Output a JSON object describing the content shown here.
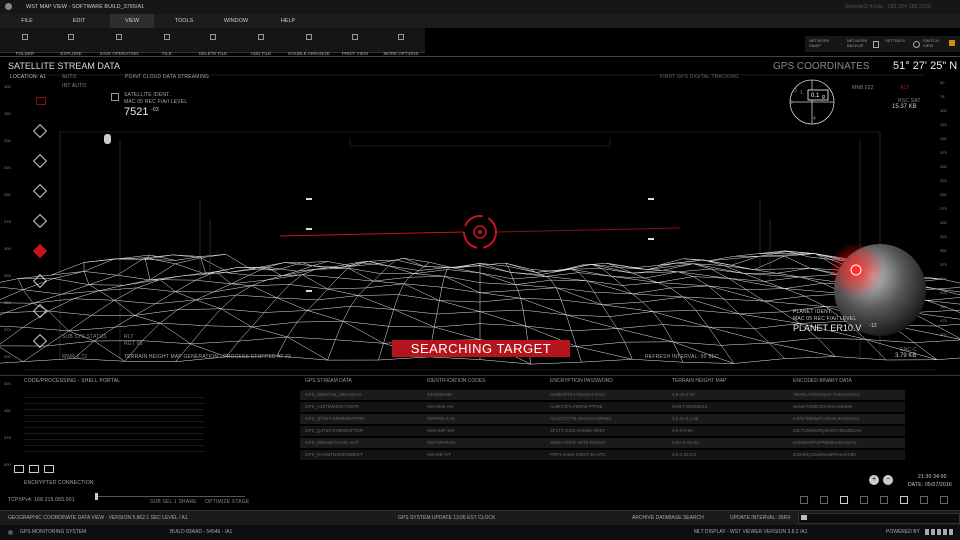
{
  "window": {
    "title": "WST MAP VIEW - SOFTWARE BUILD_3765/A1",
    "host_info": "Gnsstar3742sts : 185.264.188.2256"
  },
  "menu": [
    "FILE",
    "EDIT",
    "VIEW",
    "TOOLS",
    "WINDOW",
    "HELP"
  ],
  "toolbar": [
    "FOLDER",
    "EXPLORE",
    "SAVE OPERATION",
    "FILE",
    "DELETE FILE",
    "ADD FILE",
    "DOUBLE ARRANGE",
    "PRINT VIEW",
    "MORE OPTIONS"
  ],
  "right_toolbar": [
    "NETWORK SWAP",
    "NETWORK BACKUP",
    "SETTINGS",
    "SWITCH VIEW"
  ],
  "header": {
    "left_title": "SATELLITE STREAM DATA",
    "location": "LOCATION: A1",
    "auto1": "AUTO",
    "auto2": "INT AUTO",
    "stream": "POINT CLOUD DATA STREAMING",
    "gps_title": "GPS COORDINATES",
    "gps_value": "51° 27' 25\" N",
    "gps_sub": "FIRST GPS DIGITAL TRACKING"
  },
  "satellite": {
    "ident": "SATELLITE IDENT.",
    "rec": "MAC 05 REC F/A/I LEVEL",
    "value": "7521",
    "exp": "-03"
  },
  "compass": {
    "value": "0.1",
    "unit": "g",
    "ticks": [
      "1",
      "2",
      "3",
      "4"
    ]
  },
  "right_stats": {
    "code": "MN8.022",
    "red_label": "ALT",
    "rsc": "RSC SAT",
    "kb1": "15.37 KB",
    "enc": "ENC-C",
    "kb2": "3.79 KB"
  },
  "planet": {
    "ident": "PLANET IDENT.",
    "rec": "MAC 05 REC F/A/I LEVEL",
    "name": "PLANET ER10.V",
    "exp": "-12"
  },
  "scene": {
    "left_note_1": "MWR 0.72",
    "left_note_2": "SUB SYS STATUS",
    "terrain": "TERRAIN HEIGHT MAP GENERATION - PROCESS STOPPED AT 22",
    "refresh": "REFRESH INTERVAL: 00 SEC",
    "rlt": "RLT",
    "rlt2": "RGT 00",
    "target_label": "SEARCHING TARGET"
  },
  "ruler": [
    "100",
    "150",
    "200",
    "225",
    "250",
    "275",
    "300",
    "325",
    "350",
    "375",
    "400",
    "425",
    "450",
    "475",
    "500"
  ],
  "right_ruler": [
    "50",
    "75",
    "100",
    "125",
    "150",
    "175",
    "200",
    "225",
    "250",
    "275",
    "300",
    "325",
    "350",
    "375",
    "400",
    "425",
    "450",
    "475",
    "500"
  ],
  "code_panel": {
    "title": "CODE/PROCESSING - SHELL PORTAL",
    "encrypted": "ENCRYPTED CONNECTION",
    "ip": "TCP/IPv4: 168.215.055.001",
    "slider": "SUB SEL 1 SHARE",
    "slider2": "OPTIMIZE STAGE"
  },
  "table": {
    "headers": [
      "GPS STREAM DATA",
      "IDENTIFICATION CODES",
      "ENCRYPTION PASSWORD",
      "TERRAIN HEIGHT MAP",
      "ENCODED BINARY DATA"
    ],
    "rows": [
      [
        "GPS_NBR0736_0BEA2/2.G",
        "S4O008C88",
        "GK8D4F5TJ-FB4G8-FJA01",
        "2.8-43.2.00",
        "7BA9CAYMN1QX0-7GEx6x0k1O"
      ],
      [
        "GPS_A36T5W4G8-T0SFR",
        "SM-4520-AN",
        "AL8KT4P1-FBWW-P7F5E",
        "R4N-T4WSNM1S",
        "x6A6eT098tVZX-B4V1xb6kNt"
      ],
      [
        "GPS_QT5KT-ERMNRUFTOR",
        "SM-RRK-1AS",
        "ALGCFCTT8-GH2HO-A8FMM",
        "3.0.11-0.2.08",
        "eJVG7BM4aP1V0UuL9U4G0x4u"
      ],
      [
        "GPS_Q4T5T-5TMNRUFTOR",
        "SM4-B4F-MX",
        "SF1T7-GIO1-8HM4K-3RKT",
        "3.0-0.0-9K",
        "x3C7UWeG0Ry4N0SYJB4d0UAw"
      ],
      [
        "GPS_WBH4E7H-AXL-SAT",
        "SM-T0R-RAN",
        "SBRH-7GFR-4ST5-PKGKN",
        "9.0A-5.Y0-8A",
        "eVb1BGRP4FP5t09nU8A4xFvx"
      ],
      [
        "GPS_RHSMTBSMR45BEKT",
        "SM-4NF-KT",
        "PRF1-4H4S-GW6T-3H-4T4",
        "3.0-4.32-3.0",
        "B18AEfyS2a8IMu6RRvu4KX8h"
      ]
    ]
  },
  "clock": {
    "time": "21:30:34:00",
    "date": "DATE: 05/07/2016"
  },
  "status1": {
    "left": "GEOGRAPHIC COORDINATE DATA VIEW - VERSION 5.862.1 SEC LEVEL / A1",
    "mid": "GPS SYSTEM UPDATE 13:05 EST CLOCK",
    "archive": "ARCHIVE DATABASE SEARCH",
    "update": "UPDATE INTERVAL: 26RX"
  },
  "status2": {
    "left": "GPS MONITORING SYSTEM",
    "build": "BUILD 83AAD - 54546 - /A1",
    "mid": "MLT DISPLAY - WST VIEWER VERSION 3.8.2 /A1",
    "powered": "POWERED BY"
  },
  "colors": {
    "accent_red": "#c8141e",
    "bg": "#000000",
    "mesh": "#e8e8e8"
  }
}
